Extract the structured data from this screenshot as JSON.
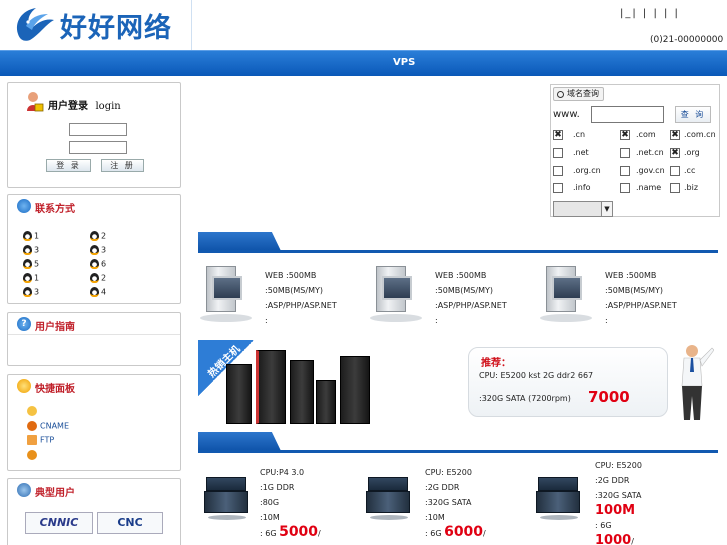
{
  "header": {
    "logo_text": "好好网络",
    "top_links": "|_|  |  |  |  |",
    "phone": "(0)21-00000000"
  },
  "nav": {
    "items": [
      "VPS"
    ]
  },
  "login": {
    "title": "用户登录",
    "title_en": "login",
    "login_btn": "登 录",
    "register_btn": "注 册",
    "icon": "user-lock-icon"
  },
  "contact": {
    "title": "联系方式",
    "icon": "qq-icon",
    "left": [
      "1",
      "3",
      "5",
      "1",
      "3"
    ],
    "right": [
      "2",
      "3",
      "6",
      "2",
      "4"
    ]
  },
  "guide": {
    "title": "用户指南"
  },
  "tools": {
    "title": "快捷面板",
    "items": [
      "",
      "CNAME",
      "FTP",
      ""
    ]
  },
  "users": {
    "title": "典型用户",
    "logos": [
      "CNNIC",
      "CNC"
    ]
  },
  "domain": {
    "tab_label": "域名查询",
    "prefix": "www.",
    "search_btn": "查 询",
    "tlds": [
      {
        "name": ".cn",
        "checked": true
      },
      {
        "name": ".com",
        "checked": true
      },
      {
        "name": ".com.cn",
        "checked": true
      },
      {
        "name": ".net",
        "checked": false
      },
      {
        "name": ".net.cn",
        "checked": false
      },
      {
        "name": ".org",
        "checked": true
      },
      {
        "name": ".org.cn",
        "checked": false
      },
      {
        "name": ".gov.cn",
        "checked": false
      },
      {
        "name": ".cc",
        "checked": false
      },
      {
        "name": ".info",
        "checked": false
      },
      {
        "name": ".name",
        "checked": false
      },
      {
        "name": ".biz",
        "checked": false
      }
    ],
    "select_value": ""
  },
  "vhost": {
    "products": [
      {
        "l1": "WEB  :500MB",
        "l2": " :50MB(MS/MY)",
        "l3": ":ASP/PHP/ASP.NET",
        "l4": ":"
      },
      {
        "l1": "WEB  :500MB",
        "l2": " :50MB(MS/MY)",
        "l3": ":ASP/PHP/ASP.NET",
        "l4": ":"
      },
      {
        "l1": "WEB  :500MB",
        "l2": " :50MB(MS/MY)",
        "l3": ":ASP/PHP/ASP.NET",
        "l4": ":"
      }
    ]
  },
  "promo": {
    "ribbon": "热销主机",
    "recommend": "推荐：",
    "cpu_line": "CPU:  E5200    kst 2G ddr2 667",
    "disk_line": ":320G SATA (7200rpm)",
    "price": "7000"
  },
  "dedicated": {
    "products": [
      {
        "cpu": "CPU:P4 3.0",
        "ram": ":1G DDR",
        "disk": ":80G",
        "bw": ":10M",
        "ip": ":  6G",
        "price": "5000",
        "suffix": "/"
      },
      {
        "cpu": "CPU: E5200",
        "ram": ":2G DDR",
        "disk": ":320G SATA",
        "bw": ":10M",
        "ip": ":  6G",
        "price": "6000",
        "suffix": "/"
      },
      {
        "cpu": "CPU: E5200",
        "ram": ":2G DDR",
        "disk": ":320G SATA",
        "bw": "100M",
        "ip": ":  6G",
        "price": "1000",
        "suffix": "/"
      }
    ]
  },
  "colors": {
    "nav_blue": "#0a58b8",
    "accent_red": "#e00012",
    "title_red": "#c0202a"
  }
}
